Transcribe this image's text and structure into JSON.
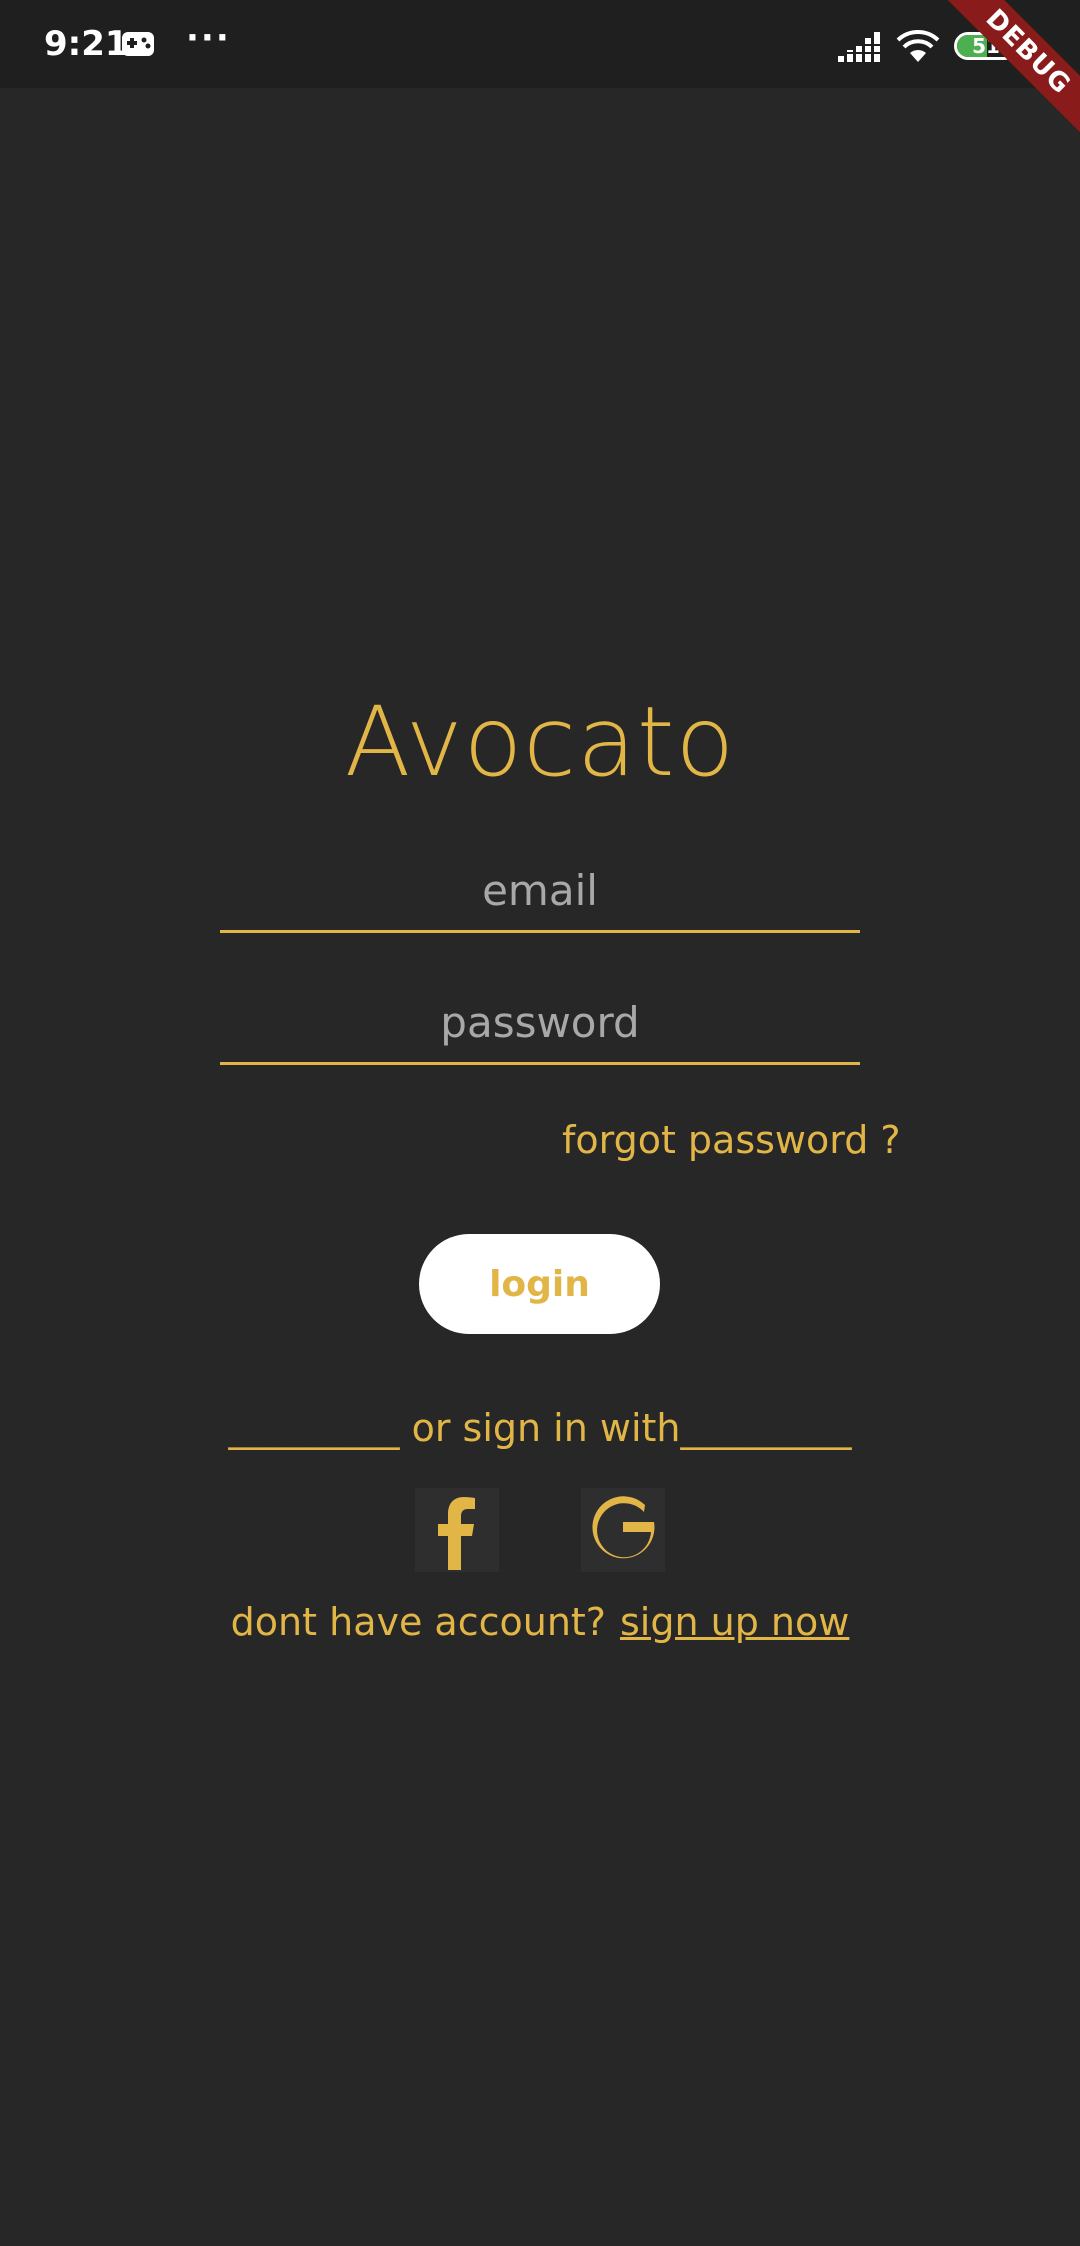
{
  "status_bar": {
    "time": "9:21",
    "dots": "···",
    "battery_level": 51,
    "battery_text": "51",
    "icons": [
      "gamepad-icon",
      "signal-icon",
      "wifi-icon",
      "battery-icon"
    ]
  },
  "debug_banner": {
    "label": "DEBUG"
  },
  "login": {
    "title": "Avocato",
    "email": {
      "placeholder": "email",
      "value": ""
    },
    "password": {
      "placeholder": "password",
      "value": ""
    },
    "forgot_label": "forgot password ?",
    "login_label": "login",
    "divider_label": "_________ or sign in with_________",
    "social": [
      "facebook-icon",
      "google-icon"
    ],
    "signup_prompt": "dont have account?",
    "signup_link": "sign up now"
  },
  "colors": {
    "background": "#272727",
    "status_bar": "#1f1f1f",
    "accent": "#e2b547",
    "button_bg": "#ffffff",
    "placeholder": "#a8a8a8",
    "debug": "#8a1b1b",
    "battery": "#4caf50"
  }
}
